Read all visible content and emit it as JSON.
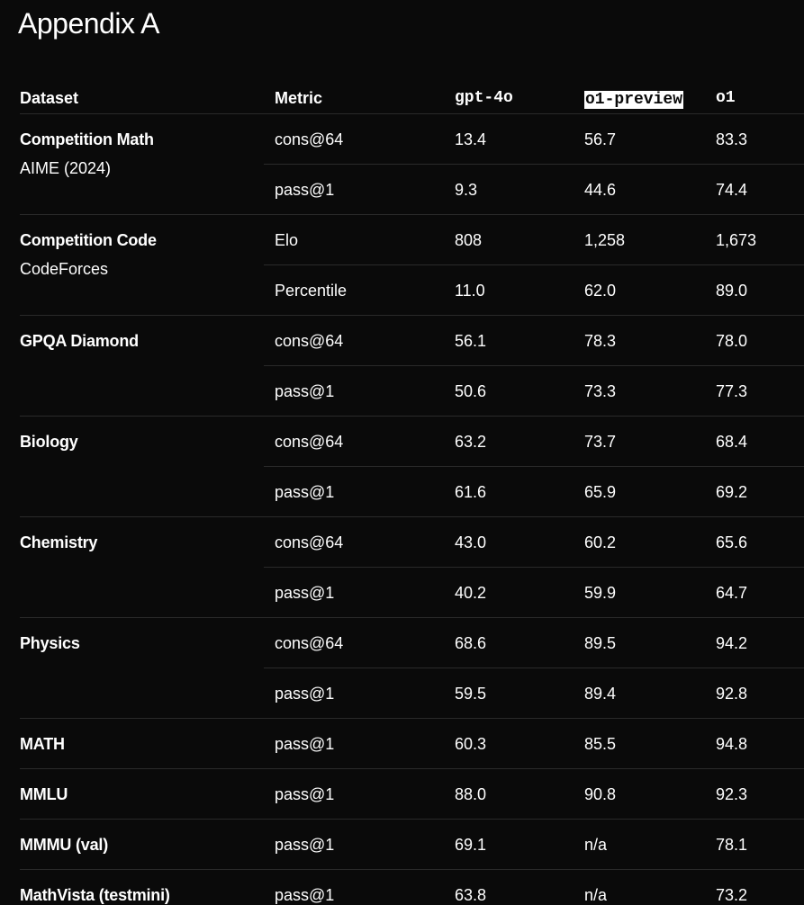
{
  "title": "Appendix A",
  "table": {
    "headers": {
      "dataset": "Dataset",
      "metric": "Metric",
      "gpt": "gpt-4o",
      "preview": "o1-preview",
      "o1": "o1"
    },
    "rows": [
      {
        "dataset": "Competition Math",
        "sub": "AIME (2024)",
        "metric": "cons@64",
        "gpt": "13.4",
        "preview": "56.7",
        "o1": "83.3"
      },
      {
        "dataset": "",
        "sub": "",
        "metric": "pass@1",
        "gpt": "9.3",
        "preview": "44.6",
        "o1": "74.4"
      },
      {
        "dataset": "Competition Code",
        "sub": "CodeForces",
        "metric": "Elo",
        "gpt": "808",
        "preview": "1,258",
        "o1": "1,673"
      },
      {
        "dataset": "",
        "sub": "",
        "metric": "Percentile",
        "gpt": "11.0",
        "preview": "62.0",
        "o1": "89.0"
      },
      {
        "dataset": "GPQA Diamond",
        "sub": "",
        "metric": "cons@64",
        "gpt": "56.1",
        "preview": "78.3",
        "o1": "78.0"
      },
      {
        "dataset": "",
        "sub": "",
        "metric": "pass@1",
        "gpt": "50.6",
        "preview": "73.3",
        "o1": "77.3"
      },
      {
        "dataset": "Biology",
        "sub": "",
        "metric": "cons@64",
        "gpt": "63.2",
        "preview": "73.7",
        "o1": "68.4"
      },
      {
        "dataset": "",
        "sub": "",
        "metric": "pass@1",
        "gpt": "61.6",
        "preview": "65.9",
        "o1": "69.2"
      },
      {
        "dataset": "Chemistry",
        "sub": "",
        "metric": "cons@64",
        "gpt": "43.0",
        "preview": "60.2",
        "o1": "65.6"
      },
      {
        "dataset": "",
        "sub": "",
        "metric": "pass@1",
        "gpt": "40.2",
        "preview": "59.9",
        "o1": "64.7"
      },
      {
        "dataset": "Physics",
        "sub": "",
        "metric": "cons@64",
        "gpt": "68.6",
        "preview": "89.5",
        "o1": "94.2"
      },
      {
        "dataset": "",
        "sub": "",
        "metric": "pass@1",
        "gpt": "59.5",
        "preview": "89.4",
        "o1": "92.8"
      },
      {
        "dataset": "MATH",
        "sub": "",
        "metric": "pass@1",
        "gpt": "60.3",
        "preview": "85.5",
        "o1": "94.8"
      },
      {
        "dataset": "MMLU",
        "sub": "",
        "metric": "pass@1",
        "gpt": "88.0",
        "preview": "90.8",
        "o1": "92.3"
      },
      {
        "dataset": "MMMU (val)",
        "sub": "",
        "metric": "pass@1",
        "gpt": "69.1",
        "preview": "n/a",
        "o1": "78.1"
      },
      {
        "dataset": "MathVista (testmini)",
        "sub": "",
        "metric": "pass@1",
        "gpt": "63.8",
        "preview": "n/a",
        "o1": "73.2"
      }
    ]
  }
}
